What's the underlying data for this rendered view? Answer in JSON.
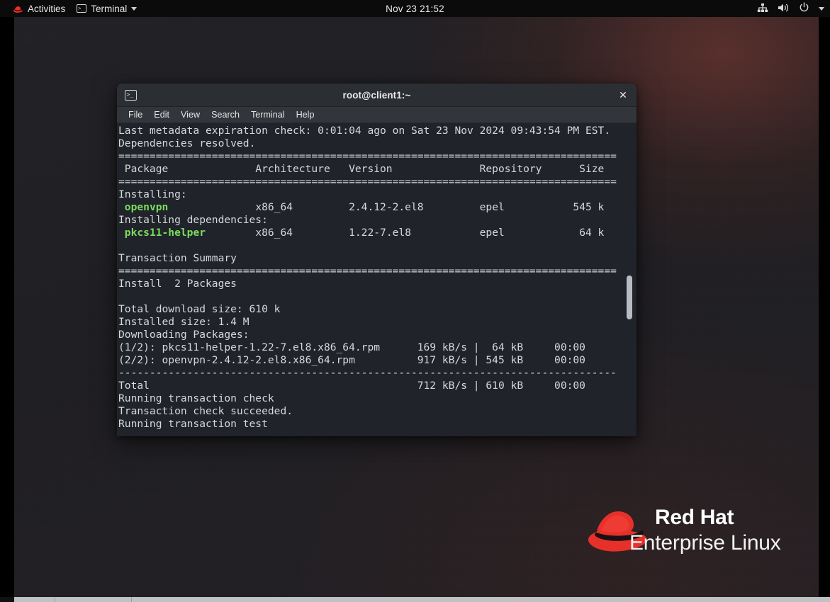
{
  "topbar": {
    "activities_label": "Activities",
    "activities_icon": "redhat-logo-icon",
    "app_label": "Terminal",
    "app_icon": "terminal-icon",
    "app_caret_icon": "chevron-down-icon",
    "clock": "Nov 23  21:52",
    "right_icons": [
      "network-wired-icon",
      "volume-icon",
      "power-icon",
      "chevron-down-icon"
    ]
  },
  "window": {
    "title": "root@client1:~",
    "icon": "terminal-icon",
    "close_label": "✕",
    "menu": [
      "File",
      "Edit",
      "View",
      "Search",
      "Terminal",
      "Help"
    ]
  },
  "terminal": {
    "prompt_colors": {
      "text": "#d6d8da",
      "package": "#7ddb5e",
      "background": "#20242a"
    },
    "lines": [
      {
        "text": "Last metadata expiration check: 0:01:04 ago on Sat 23 Nov 2024 09:43:54 PM EST."
      },
      {
        "text": "Dependencies resolved."
      },
      {
        "text": "================================================================================"
      },
      {
        "text": " Package              Architecture   Version              Repository      Size"
      },
      {
        "text": "================================================================================"
      },
      {
        "text": "Installing:"
      },
      {
        "text": " openvpn              x86_64         2.4.12-2.el8         epel           545 k",
        "pkg": "openvpn",
        "pkg_start": 1
      },
      {
        "text": "Installing dependencies:"
      },
      {
        "text": " pkcs11-helper        x86_64         1.22-7.el8           epel            64 k",
        "pkg": "pkcs11-helper",
        "pkg_start": 1
      },
      {
        "text": ""
      },
      {
        "text": "Transaction Summary"
      },
      {
        "text": "================================================================================"
      },
      {
        "text": "Install  2 Packages"
      },
      {
        "text": ""
      },
      {
        "text": "Total download size: 610 k"
      },
      {
        "text": "Installed size: 1.4 M"
      },
      {
        "text": "Downloading Packages:"
      },
      {
        "text": "(1/2): pkcs11-helper-1.22-7.el8.x86_64.rpm      169 kB/s |  64 kB     00:00"
      },
      {
        "text": "(2/2): openvpn-2.4.12-2.el8.x86_64.rpm          917 kB/s | 545 kB     00:00"
      },
      {
        "text": "--------------------------------------------------------------------------------"
      },
      {
        "text": "Total                                           712 kB/s | 610 kB     00:00"
      },
      {
        "text": "Running transaction check"
      },
      {
        "text": "Transaction check succeeded."
      },
      {
        "text": "Running transaction test"
      }
    ]
  },
  "desktop": {
    "logo_line1": "Red Hat",
    "logo_line2": "Enterprise Linux",
    "logo_icon": "redhat-fedora-icon"
  }
}
